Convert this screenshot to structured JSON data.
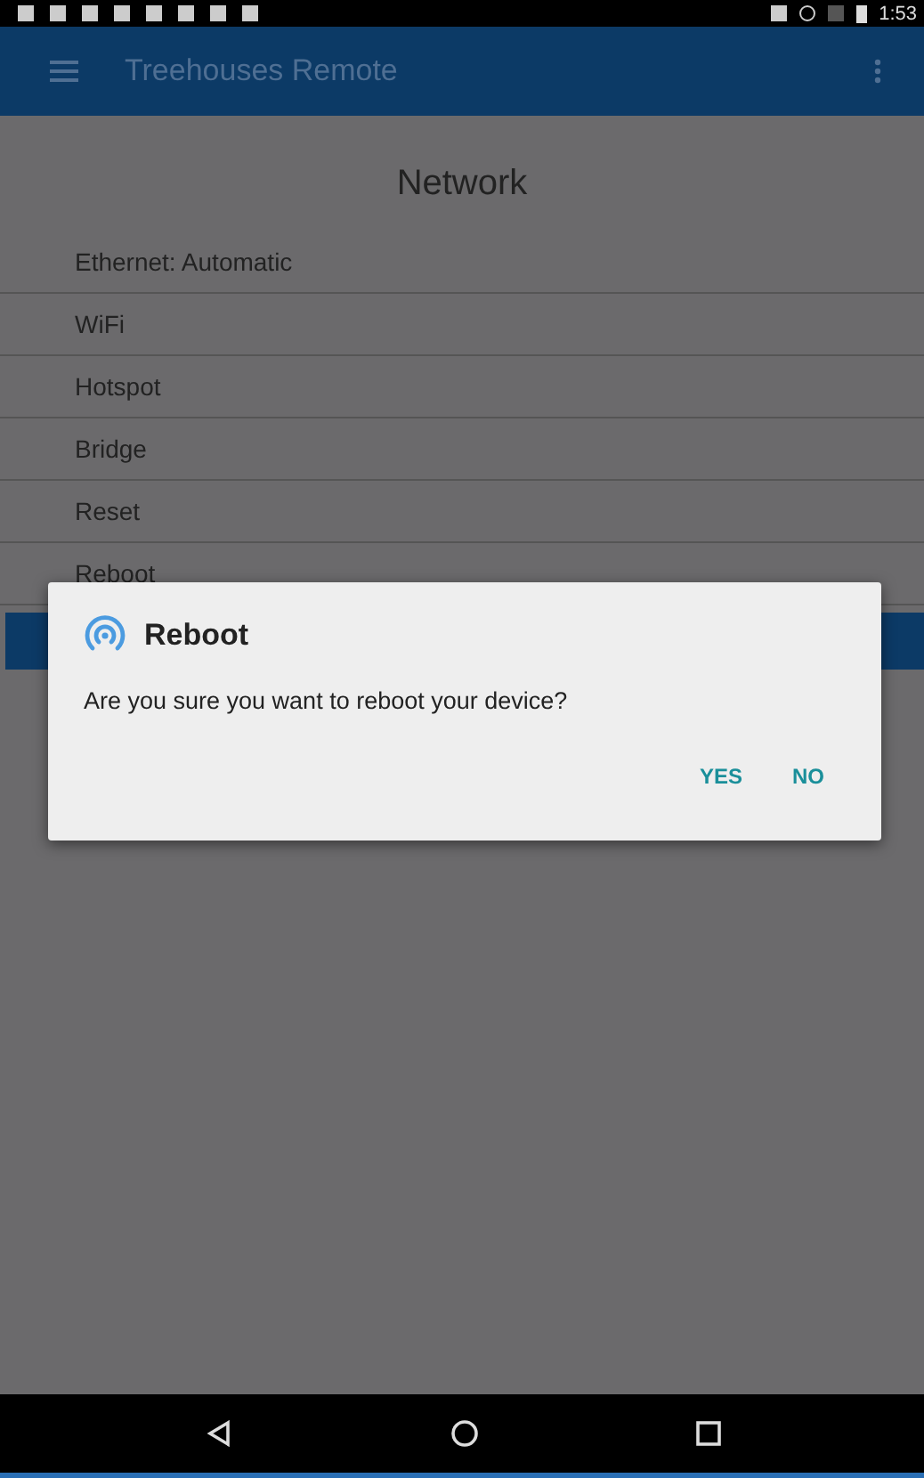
{
  "status_bar": {
    "time": "1:53"
  },
  "app_bar": {
    "title": "Treehouses Remote"
  },
  "page": {
    "title": "Network",
    "items": [
      {
        "label": "Ethernet: Automatic"
      },
      {
        "label": "WiFi"
      },
      {
        "label": "Hotspot"
      },
      {
        "label": "Bridge"
      },
      {
        "label": "Reset"
      },
      {
        "label": "Reboot"
      }
    ]
  },
  "dialog": {
    "title": "Reboot",
    "message": "Are you sure you want to reboot your device?",
    "buttons": [
      "YES",
      "NO"
    ]
  }
}
